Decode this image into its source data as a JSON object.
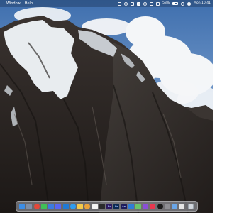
{
  "menubar": {
    "apple_logo": "apple-icon",
    "items": [
      "Window",
      "Help"
    ],
    "status": {
      "battery_percent": "53%",
      "clock": "Mon 10:41"
    }
  },
  "wallpaper": {
    "sky_color": "#5d82b5",
    "rock_color": "#2b2523",
    "snow_color": "#e8ecef"
  },
  "dock": {
    "apps": [
      {
        "name": "finder-icon",
        "color": "#3d8ee6"
      },
      {
        "name": "launchpad-icon",
        "color": "#7f8fa6"
      },
      {
        "name": "chrome-icon",
        "color": "#e3483a"
      },
      {
        "name": "messages-icon",
        "color": "#40c057"
      },
      {
        "name": "mail-icon",
        "color": "#3b7be0"
      },
      {
        "name": "discord-icon",
        "color": "#5865f2"
      },
      {
        "name": "vscode-icon",
        "color": "#1f7ad6"
      },
      {
        "name": "safari-icon",
        "color": "#2e9cf0"
      },
      {
        "name": "notes-icon",
        "color": "#f2c94c"
      },
      {
        "name": "photos-icon",
        "color": "#e9a23b"
      },
      {
        "name": "calendar-icon",
        "color": "#f4f4f4"
      },
      {
        "name": "terminal-icon",
        "color": "#2b2b2b"
      },
      {
        "name": "premiere-icon",
        "color": "#2c1a5e",
        "label": "Pr"
      },
      {
        "name": "photoshop-icon",
        "color": "#0c2a52",
        "label": "Ps"
      },
      {
        "name": "after-effects-icon",
        "color": "#1e1c5a",
        "label": "Ae"
      },
      {
        "name": "xcode-icon",
        "color": "#2f7dd8"
      },
      {
        "name": "maps-icon",
        "color": "#6cc46a"
      },
      {
        "name": "figma-icon",
        "color": "#8a4fd8"
      },
      {
        "name": "music-icon",
        "color": "#e8384f"
      },
      {
        "name": "activity-monitor-icon",
        "color": "#1b1b1b"
      },
      {
        "name": "system-settings-icon",
        "color": "#8e8e93"
      },
      {
        "name": "preview-icon",
        "color": "#6aa6e8"
      },
      {
        "name": "stickies-icon",
        "color": "#e6e6e6"
      }
    ],
    "trash": "trash-icon"
  }
}
